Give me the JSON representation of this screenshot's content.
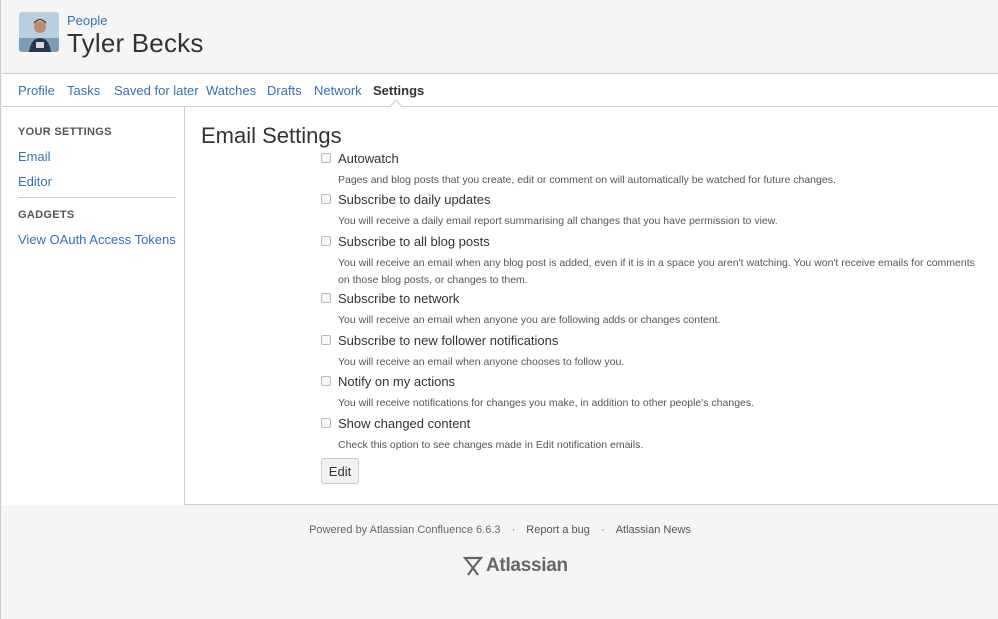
{
  "header": {
    "breadcrumb": "People",
    "title": "Tyler Becks"
  },
  "tabs": [
    {
      "label": "Profile"
    },
    {
      "label": "Tasks"
    },
    {
      "label": "Saved for later"
    },
    {
      "label": "Watches"
    },
    {
      "label": "Drafts"
    },
    {
      "label": "Network"
    },
    {
      "label": "Settings",
      "active": true
    }
  ],
  "sidebar": {
    "your_settings_heading": "YOUR SETTINGS",
    "email": "Email",
    "editor": "Editor",
    "gadgets_heading": "GADGETS",
    "oauth": "View OAuth Access Tokens"
  },
  "main": {
    "title": "Email Settings",
    "settings": [
      {
        "label": "Autowatch",
        "desc": "Pages and blog posts that you create, edit or comment on will automatically be watched for future changes.",
        "checked": false
      },
      {
        "label": "Subscribe to daily updates",
        "desc": "You will receive a daily email report summarising all changes that you have permission to view.",
        "checked": false
      },
      {
        "label": "Subscribe to all blog posts",
        "desc": "You will receive an email when any blog post is added, even if it is in a space you aren't watching. You won't receive emails for comments on those blog posts, or changes to them.",
        "checked": false
      },
      {
        "label": "Subscribe to network",
        "desc": "You will receive an email when anyone you are following adds or changes content.",
        "checked": false
      },
      {
        "label": "Subscribe to new follower notifications",
        "desc": "You will receive an email when anyone chooses to follow you.",
        "checked": false
      },
      {
        "label": "Notify on my actions",
        "desc": "You will receive notifications for changes you make, in addition to other people's changes.",
        "checked": false
      },
      {
        "label": "Show changed content",
        "desc": "Check this option to see changes made in Edit notification emails.",
        "checked": false
      }
    ],
    "edit_label": "Edit"
  },
  "footer": {
    "powered_by": "Powered by Atlassian Confluence 6.6.3",
    "separator": "·",
    "report_bug": "Report a bug",
    "news": "Atlassian News",
    "logo": "Atlassian"
  },
  "colors": {
    "link": "#3572b0",
    "text": "#333333"
  }
}
